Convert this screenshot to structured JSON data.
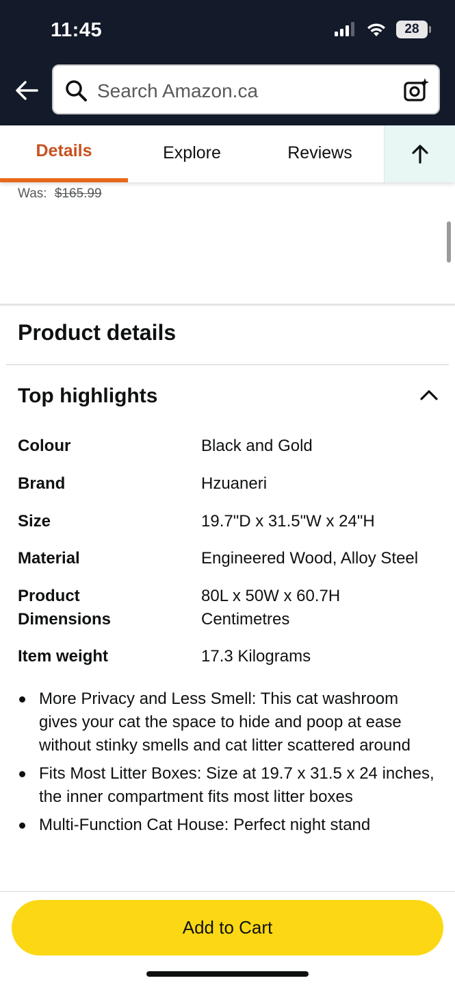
{
  "status_bar": {
    "time": "11:45",
    "battery": "28"
  },
  "search": {
    "placeholder": "Search Amazon.ca"
  },
  "tabs": [
    {
      "label": "Details"
    },
    {
      "label": "Explore"
    },
    {
      "label": "Reviews"
    }
  ],
  "price": {
    "was_label": "Was:",
    "was_value": "$165.99"
  },
  "product_details": {
    "title": "Product details",
    "highlights_title": "Top highlights",
    "specs": [
      {
        "label": "Colour",
        "value": "Black and Gold"
      },
      {
        "label": "Brand",
        "value": "Hzuaneri"
      },
      {
        "label": "Size",
        "value": "19.7\"D x 31.5\"W x 24\"H"
      },
      {
        "label": "Material",
        "value": "Engineered Wood, Alloy Steel"
      },
      {
        "label": "Product Dimensions",
        "value": "80L x 50W x 60.7H Centimetres"
      },
      {
        "label": "Item weight",
        "value": "17.3 Kilograms"
      }
    ],
    "bullets": [
      "More Privacy and Less Smell: This cat washroom gives your cat the space to hide and poop at ease without stinky smells and cat litter scattered around",
      "Fits Most Litter Boxes: Size at 19.7 x 31.5 x 24 inches, the inner compartment fits most litter boxes",
      "Multi-Function Cat House: Perfect night stand"
    ]
  },
  "bottom": {
    "add_to_cart": "Add to Cart"
  },
  "colors": {
    "header_bg": "#131a2a",
    "accent_orange": "#e8681a",
    "cart_button": "#fcd814",
    "tab_active_text": "#c7511f"
  },
  "icons": [
    "cellular-signal-icon",
    "wifi-icon",
    "battery-icon",
    "back-arrow-icon",
    "search-icon",
    "camera-search-icon",
    "arrow-up-icon",
    "chevron-up-icon"
  ]
}
